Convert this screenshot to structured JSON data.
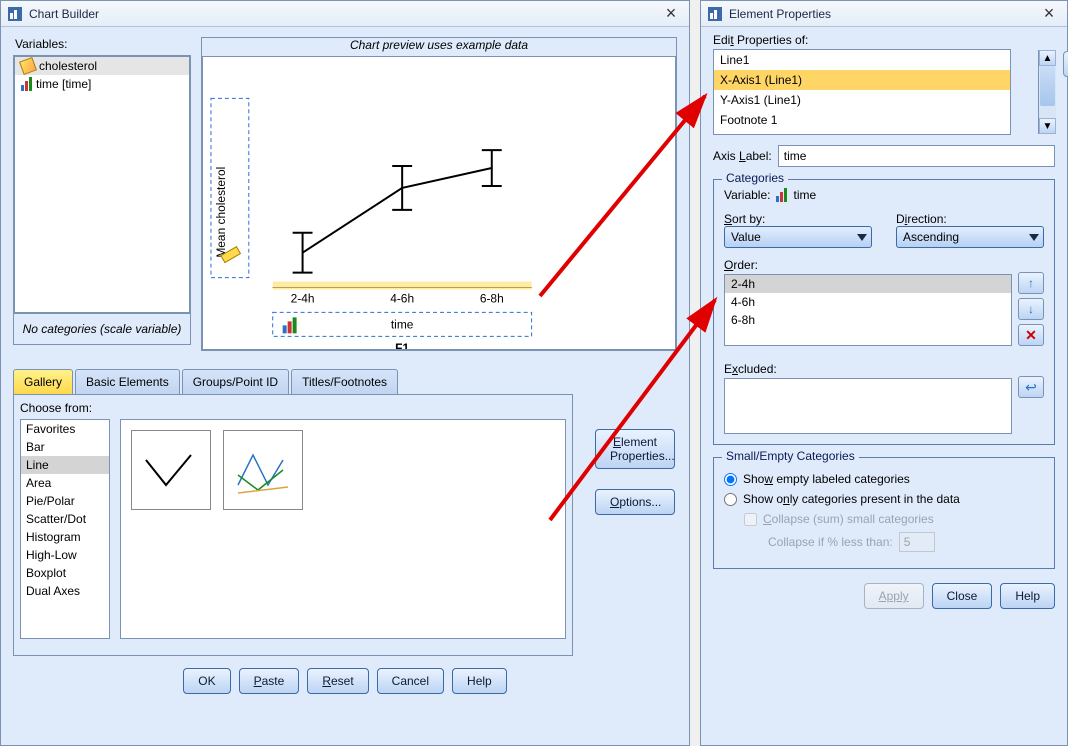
{
  "chartBuilder": {
    "title": "Chart Builder",
    "variablesLabel": "Variables:",
    "variables": [
      {
        "label": "cholesterol",
        "icon": "ruler-icon"
      },
      {
        "label": "time [time]",
        "icon": "bars-icon"
      }
    ],
    "noCategories": "No categories (scale variable)",
    "previewTitle": "Chart preview uses example data",
    "preview": {
      "yLabel": "Mean cholesterol",
      "xLabel": "time",
      "factorLabel": "F1",
      "ticks": [
        "2-4h",
        "4-6h",
        "6-8h"
      ]
    },
    "tabs": [
      "Gallery",
      "Basic Elements",
      "Groups/Point ID",
      "Titles/Footnotes"
    ],
    "chooseFrom": "Choose from:",
    "galleryTypes": [
      "Favorites",
      "Bar",
      "Line",
      "Area",
      "Pie/Polar",
      "Scatter/Dot",
      "Histogram",
      "High-Low",
      "Boxplot",
      "Dual Axes"
    ],
    "sideButtons": {
      "elementProps": "Element Properties...",
      "options": "Options..."
    },
    "bottom": {
      "ok": "OK",
      "paste": "Paste",
      "reset": "Reset",
      "cancel": "Cancel",
      "help": "Help"
    }
  },
  "elementProps": {
    "title": "Element Properties",
    "editLabel": "Edit Properties of:",
    "items": [
      "Line1",
      "X-Axis1 (Line1)",
      "Y-Axis1 (Line1)",
      "Footnote 1"
    ],
    "axisLabelLabel": "Axis Label:",
    "axisLabelValue": "time",
    "categories": {
      "legend": "Categories",
      "variableLabel": "Variable:",
      "variableValue": "time",
      "sortByLabel": "Sort by:",
      "sortBy": "Value",
      "directionLabel": "Direction:",
      "direction": "Ascending",
      "orderLabel": "Order:",
      "order": [
        "2-4h",
        "4-6h",
        "6-8h"
      ],
      "excludedLabel": "Excluded:"
    },
    "smallEmpty": {
      "legend": "Small/Empty Categories",
      "showEmpty": "Show empty labeled categories",
      "showOnly": "Show only categories present in the data",
      "collapseSum": "Collapse (sum) small categories",
      "collapsePct": "Collapse if % less than:",
      "pctValue": "5"
    },
    "bottom": {
      "apply": "Apply",
      "close": "Close",
      "help": "Help"
    }
  },
  "chart_data": {
    "type": "line",
    "title": "Chart preview uses example data",
    "xlabel": "time",
    "ylabel": "Mean cholesterol",
    "categories": [
      "2-4h",
      "4-6h",
      "6-8h"
    ],
    "series": [
      {
        "name": "Mean cholesterol",
        "values": [
          30,
          60,
          70
        ],
        "error": [
          10,
          12,
          10
        ]
      }
    ],
    "ylim": [
      0,
      100
    ]
  }
}
